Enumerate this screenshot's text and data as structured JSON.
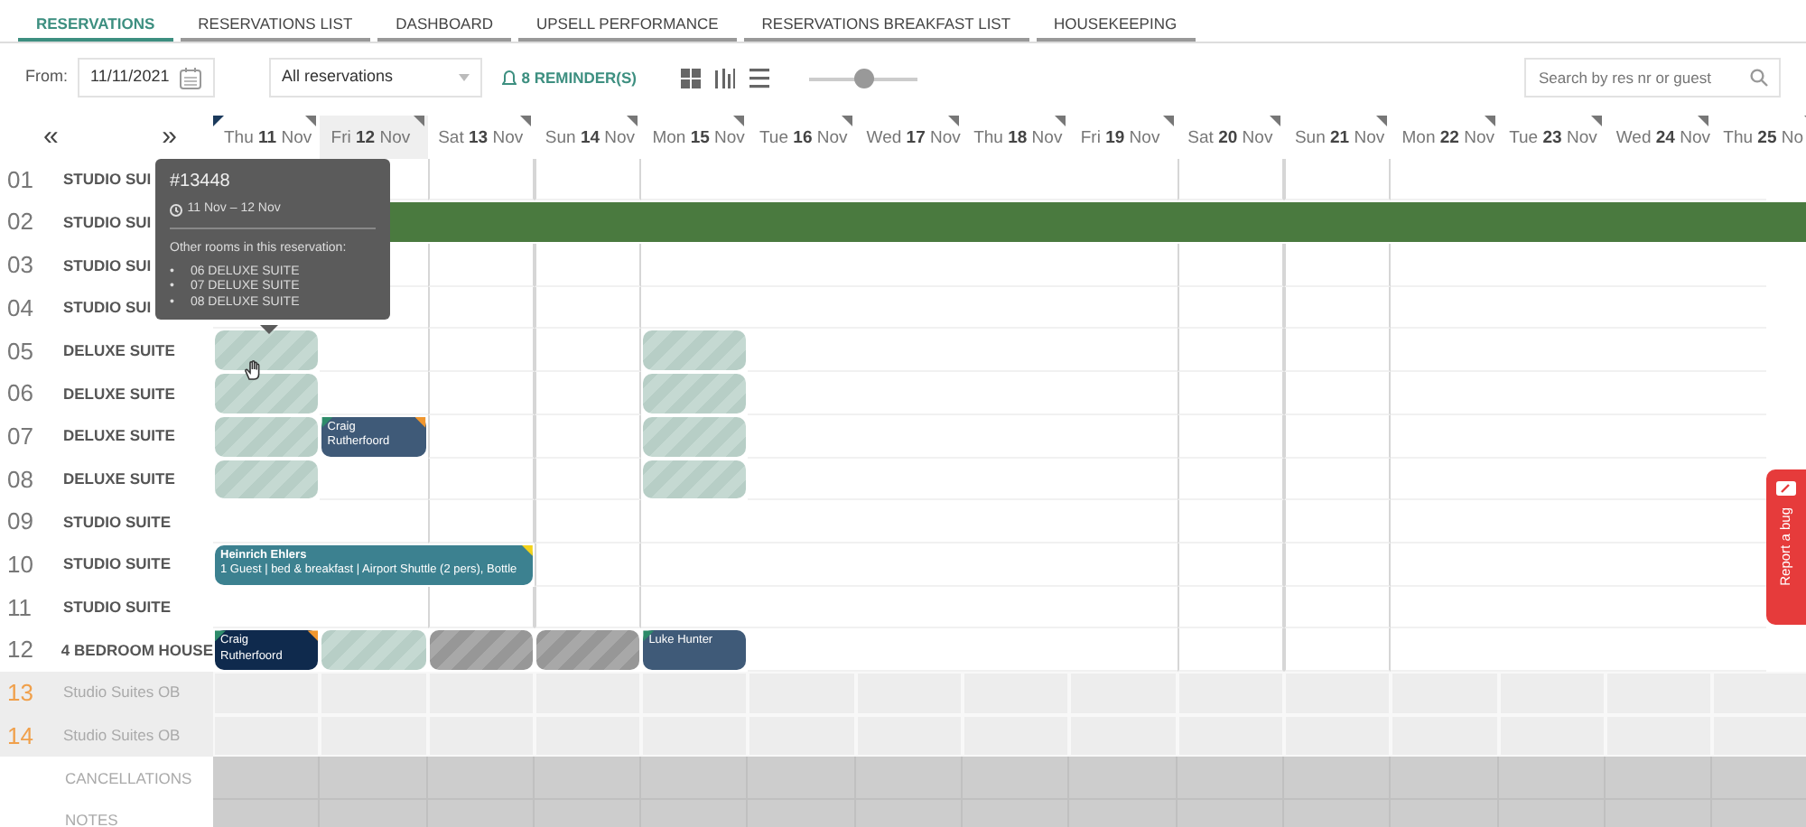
{
  "tabs": [
    {
      "label": "RESERVATIONS",
      "selected": true
    },
    {
      "label": "RESERVATIONS LIST",
      "selected": false
    },
    {
      "label": "DASHBOARD",
      "selected": false
    },
    {
      "label": "UPSELL PERFORMANCE",
      "selected": false
    },
    {
      "label": "RESERVATIONS BREAKFAST LIST",
      "selected": false
    },
    {
      "label": "HOUSEKEEPING",
      "selected": false
    }
  ],
  "toolbar": {
    "from_label": "From:",
    "date": "11/11/2021",
    "filter": "All reservations",
    "reminders": "8 REMINDER(S)",
    "zoom": {
      "level": 0.5
    },
    "search": {
      "placeholder": "Search by res nr or guest"
    }
  },
  "nav": {
    "prev": "«",
    "next": "»"
  },
  "days": [
    {
      "weekday": "Thu",
      "day": "11",
      "month": "Nov",
      "today": false,
      "weekend": false,
      "note": true
    },
    {
      "weekday": "Fri",
      "day": "12",
      "month": "Nov",
      "today": true,
      "weekend": false,
      "note": false
    },
    {
      "weekday": "Sat",
      "day": "13",
      "month": "Nov",
      "today": false,
      "weekend": true,
      "note": false
    },
    {
      "weekday": "Sun",
      "day": "14",
      "month": "Nov",
      "today": false,
      "weekend": true,
      "note": false
    },
    {
      "weekday": "Mon",
      "day": "15",
      "month": "Nov",
      "today": false,
      "weekend": false,
      "note": false
    },
    {
      "weekday": "Tue",
      "day": "16",
      "month": "Nov",
      "today": false,
      "weekend": false,
      "note": false
    },
    {
      "weekday": "Wed",
      "day": "17",
      "month": "Nov",
      "today": false,
      "weekend": false,
      "note": false
    },
    {
      "weekday": "Thu",
      "day": "18",
      "month": "Nov",
      "today": false,
      "weekend": false,
      "note": false
    },
    {
      "weekday": "Fri",
      "day": "19",
      "month": "Nov",
      "today": false,
      "weekend": false,
      "note": false
    },
    {
      "weekday": "Sat",
      "day": "20",
      "month": "Nov",
      "today": false,
      "weekend": true,
      "note": false
    },
    {
      "weekday": "Sun",
      "day": "21",
      "month": "Nov",
      "today": false,
      "weekend": true,
      "note": false
    },
    {
      "weekday": "Mon",
      "day": "22",
      "month": "Nov",
      "today": false,
      "weekend": false,
      "note": false
    },
    {
      "weekday": "Tue",
      "day": "23",
      "month": "Nov",
      "today": false,
      "weekend": false,
      "note": false
    },
    {
      "weekday": "Wed",
      "day": "24",
      "month": "Nov",
      "today": false,
      "weekend": false,
      "note": false
    },
    {
      "weekday": "Thu",
      "day": "25",
      "month": "No",
      "today": false,
      "weekend": false,
      "note": false
    }
  ],
  "rooms": [
    {
      "number": "01",
      "name": "STUDIO SUI",
      "kind": "room"
    },
    {
      "number": "02",
      "name": "STUDIO SUI",
      "kind": "room",
      "cells": [
        {
          "kind": "empty"
        },
        {
          "kind": "bar",
          "color": "#4a7a3f"
        },
        {
          "kind": "cont"
        },
        {
          "kind": "cont"
        },
        {
          "kind": "cont"
        },
        {
          "kind": "cont"
        },
        {
          "kind": "cont"
        },
        {
          "kind": "cont"
        },
        {
          "kind": "cont"
        },
        {
          "kind": "cont"
        },
        {
          "kind": "cont"
        },
        {
          "kind": "cont"
        },
        {
          "kind": "cont"
        },
        {
          "kind": "cont"
        },
        {
          "kind": "cont"
        }
      ]
    },
    {
      "number": "03",
      "name": "STUDIO SUI",
      "kind": "room"
    },
    {
      "number": "04",
      "name": "STUDIO SUI",
      "kind": "room"
    },
    {
      "number": "05",
      "name": "DELUXE SUITE",
      "kind": "room",
      "cells": [
        {
          "kind": "pending"
        },
        {
          "kind": "empty"
        },
        {
          "kind": "empty"
        },
        {
          "kind": "empty"
        },
        {
          "kind": "pending"
        }
      ]
    },
    {
      "number": "06",
      "name": "DELUXE SUITE",
      "kind": "room",
      "cells": [
        {
          "kind": "pending"
        },
        {
          "kind": "empty"
        },
        {
          "kind": "empty"
        },
        {
          "kind": "empty"
        },
        {
          "kind": "pending"
        }
      ]
    },
    {
      "number": "07",
      "name": "DELUXE SUITE",
      "kind": "room",
      "cells": [
        {
          "kind": "pending"
        },
        {
          "kind": "guest",
          "color": "#3f5a78",
          "guest": "Craig Rutherfoord",
          "corner_left": {
            "color": "#2e8b6a"
          },
          "corner_right": {
            "color": "#f0962e"
          }
        },
        {
          "kind": "empty"
        },
        {
          "kind": "empty"
        },
        {
          "kind": "pending"
        }
      ]
    },
    {
      "number": "08",
      "name": "DELUXE SUITE",
      "kind": "room",
      "cells": [
        {
          "kind": "pending"
        },
        {
          "kind": "empty"
        },
        {
          "kind": "empty"
        },
        {
          "kind": "empty"
        },
        {
          "kind": "pending"
        }
      ]
    },
    {
      "number": "09",
      "name": "STUDIO SUITE",
      "kind": "room"
    },
    {
      "number": "10",
      "name": "STUDIO SUITE",
      "kind": "room",
      "cells": [
        {
          "kind": "guest",
          "color": "#3c8190",
          "guest": "Heinrich Ehlers",
          "details": "1 Guest | bed & breakfast | Airport Shuttle (2 pers), Bottle",
          "corner_right": {
            "color": "#f2d21b"
          }
        },
        {
          "kind": "cont"
        },
        {
          "kind": "cont"
        }
      ]
    },
    {
      "number": "11",
      "name": "STUDIO SUITE",
      "kind": "room"
    },
    {
      "number": "12",
      "name": "4 BEDROOM HOUSE",
      "kind": "room",
      "cells": [
        {
          "kind": "guest",
          "color": "#0f2a4d",
          "guest": "Craig Rutherfoord",
          "corner_left": {
            "color": "#2e8b6a"
          },
          "corner_right": {
            "color": "#f0962e"
          }
        },
        {
          "kind": "pending"
        },
        {
          "kind": "blocked"
        },
        {
          "kind": "blocked"
        },
        {
          "kind": "guest",
          "color": "#3f5a78",
          "guest": "Luke Hunter",
          "corner_left": {
            "color": "#2e8b6a"
          }
        }
      ]
    },
    {
      "number": "13",
      "name": "Studio Suites OB",
      "kind": "ob"
    },
    {
      "number": "14",
      "name": "Studio Suites OB",
      "kind": "ob"
    },
    {
      "name": "CANCELLATIONS",
      "kind": "summary"
    },
    {
      "name": "NOTES",
      "kind": "summary"
    }
  ],
  "tooltip": {
    "title": "#13448",
    "dates": "11 Nov – 12 Nov",
    "heading": "Other rooms in this reservation:",
    "rooms": [
      {
        "bullet": "•",
        "label": "06 DELUXE SUITE"
      },
      {
        "bullet": "•",
        "label": "07 DELUXE SUITE"
      },
      {
        "bullet": "•",
        "label": "08 DELUXE SUITE"
      }
    ]
  },
  "report_bug": "Report a bug"
}
